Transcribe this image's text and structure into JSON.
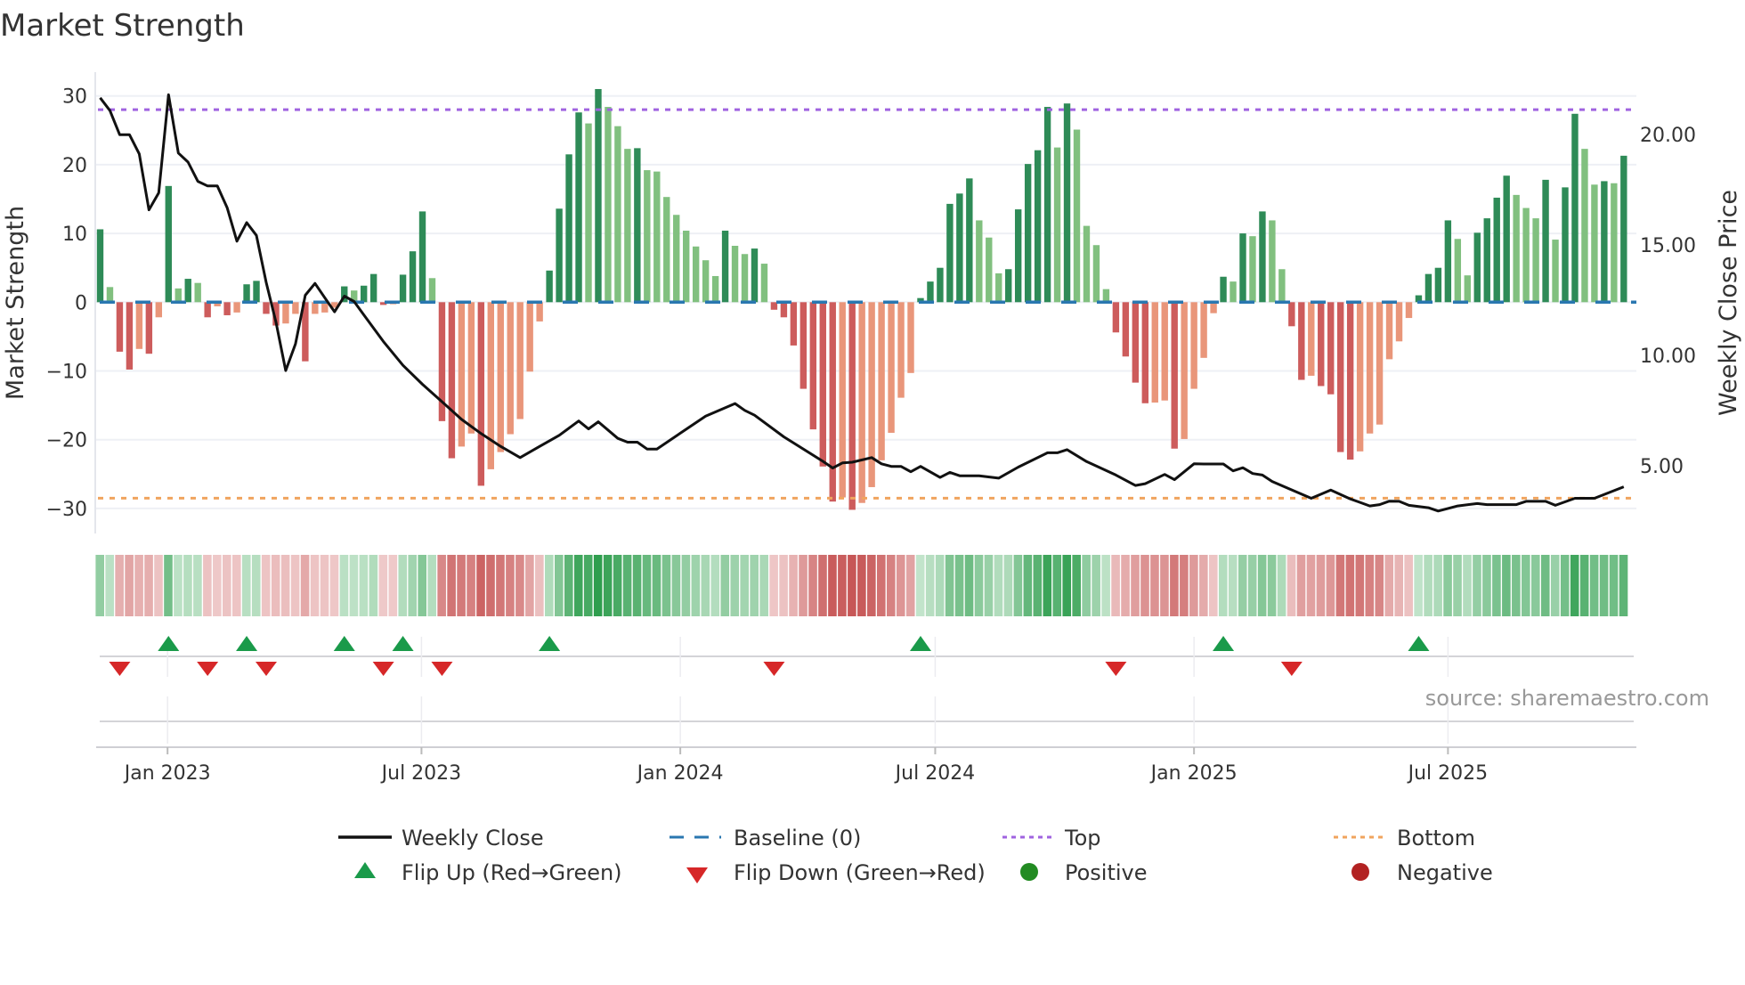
{
  "chart_data": {
    "type": "bar",
    "title": "Market Strength",
    "ylabel": "Market Strength",
    "y2label": "Weekly Close Price",
    "ylim": [
      -33,
      34
    ],
    "y2_ticks": [
      "20.00",
      "15.00",
      "10.00",
      "5.00"
    ],
    "y2_tick_values": [
      20,
      15,
      10,
      5
    ],
    "y_ticks": [
      "30",
      "20",
      "10",
      "0",
      "−10",
      "−20",
      "−30"
    ],
    "y_tick_values": [
      30,
      20,
      10,
      0,
      -10,
      -20,
      -30
    ],
    "x_ticks": [
      {
        "label": "Jan 2023",
        "week": 7.9
      },
      {
        "label": "Jul 2023",
        "week": 33.9
      },
      {
        "label": "Jan 2024",
        "week": 60.4
      },
      {
        "label": "Jul 2024",
        "week": 86.5
      },
      {
        "label": "Jan 2025",
        "week": 113.0
      },
      {
        "label": "Jul 2025",
        "week": 139.0
      }
    ],
    "top_level": 28.0,
    "bottom_level": -28.5,
    "baseline": 0,
    "strength": [
      10.6,
      2.2,
      -7.2,
      -9.8,
      -6.8,
      -7.5,
      -2.2,
      16.9,
      2.0,
      3.4,
      2.8,
      -2.2,
      -0.6,
      -1.9,
      -1.5,
      2.6,
      3.1,
      -1.7,
      -3.4,
      -3.1,
      -1.7,
      -8.6,
      -1.7,
      -1.5,
      -0.8,
      2.3,
      1.7,
      2.4,
      4.1,
      -0.4,
      -0.3,
      4.0,
      7.4,
      13.2,
      3.5,
      -17.3,
      -22.7,
      -21.0,
      -19.1,
      -26.7,
      -24.3,
      -21.8,
      -19.2,
      -17.0,
      -10.1,
      -2.8,
      4.6,
      13.6,
      21.5,
      27.6,
      26.0,
      31.0,
      28.4,
      25.6,
      22.3,
      22.4,
      19.2,
      19.0,
      15.3,
      12.7,
      10.4,
      8.1,
      6.1,
      3.8,
      10.4,
      8.2,
      7.0,
      7.8,
      5.6,
      -1.1,
      -2.2,
      -6.3,
      -12.6,
      -18.5,
      -23.9,
      -29.0,
      -28.4,
      -30.2,
      -29.2,
      -26.9,
      -23.0,
      -19.0,
      -13.9,
      -10.3,
      0.6,
      3.0,
      5.0,
      14.3,
      15.8,
      18.0,
      11.9,
      9.4,
      4.2,
      4.8,
      13.5,
      20.1,
      22.1,
      28.4,
      22.5,
      28.9,
      25.1,
      11.1,
      8.3,
      1.9,
      -4.4,
      -7.9,
      -11.7,
      -14.7,
      -14.6,
      -14.3,
      -21.3,
      -19.9,
      -12.6,
      -8.1,
      -1.6,
      3.7,
      3.0,
      10.0,
      9.6,
      13.2,
      11.9,
      4.8,
      -3.5,
      -11.3,
      -10.7,
      -12.2,
      -13.4,
      -21.8,
      -22.9,
      -21.7,
      -19.1,
      -17.8,
      -8.3,
      -5.7,
      -2.3,
      1.0,
      4.1,
      5.0,
      11.9,
      9.2,
      3.9,
      10.1,
      12.2,
      15.2,
      18.4,
      15.6,
      13.7,
      12.2,
      17.8,
      9.1,
      16.7,
      27.4,
      22.3,
      17.1,
      17.6,
      17.3,
      21.3
    ],
    "weekly_close": [
      [
        1,
        21.66
      ],
      [
        2,
        21.08
      ],
      [
        3,
        19.99
      ],
      [
        4,
        19.99
      ],
      [
        5,
        19.12
      ],
      [
        6,
        16.59
      ],
      [
        7,
        17.36
      ],
      [
        8,
        21.8
      ],
      [
        9,
        19.16
      ],
      [
        10,
        18.75
      ],
      [
        11,
        17.88
      ],
      [
        12,
        17.67
      ],
      [
        13,
        17.67
      ],
      [
        14,
        16.69
      ],
      [
        15,
        15.17
      ],
      [
        16,
        16.01
      ],
      [
        17,
        15.43
      ],
      [
        18,
        13.3
      ],
      [
        19,
        11.5
      ],
      [
        20,
        9.31
      ],
      [
        21,
        10.52
      ],
      [
        22,
        12.72
      ],
      [
        23,
        13.26
      ],
      [
        24,
        12.61
      ],
      [
        25,
        11.97
      ],
      [
        26,
        12.68
      ],
      [
        27,
        12.44
      ],
      [
        28,
        11.83
      ],
      [
        30,
        10.63
      ],
      [
        32,
        9.55
      ],
      [
        34,
        8.69
      ],
      [
        36,
        7.9
      ],
      [
        38,
        7.1
      ],
      [
        40,
        6.46
      ],
      [
        42,
        5.88
      ],
      [
        44,
        5.37
      ],
      [
        46,
        5.88
      ],
      [
        48,
        6.38
      ],
      [
        50,
        7.03
      ],
      [
        51,
        6.67
      ],
      [
        52,
        6.99
      ],
      [
        54,
        6.24
      ],
      [
        55,
        6.07
      ],
      [
        56,
        6.07
      ],
      [
        57,
        5.76
      ],
      [
        58,
        5.76
      ],
      [
        63,
        7.25
      ],
      [
        66,
        7.82
      ],
      [
        67,
        7.51
      ],
      [
        68,
        7.29
      ],
      [
        71,
        6.31
      ],
      [
        75,
        5.2
      ],
      [
        76,
        4.9
      ],
      [
        77,
        5.13
      ],
      [
        78,
        5.16
      ],
      [
        80,
        5.37
      ],
      [
        81,
        5.09
      ],
      [
        82,
        4.97
      ],
      [
        83,
        4.97
      ],
      [
        84,
        4.73
      ],
      [
        85,
        4.97
      ],
      [
        87,
        4.47
      ],
      [
        88,
        4.7
      ],
      [
        89,
        4.55
      ],
      [
        91,
        4.55
      ],
      [
        93,
        4.44
      ],
      [
        95,
        4.94
      ],
      [
        98,
        5.59
      ],
      [
        99,
        5.59
      ],
      [
        100,
        5.73
      ],
      [
        102,
        5.19
      ],
      [
        103,
        4.99
      ],
      [
        105,
        4.58
      ],
      [
        107,
        4.11
      ],
      [
        108,
        4.19
      ],
      [
        110,
        4.61
      ],
      [
        111,
        4.37
      ],
      [
        113,
        5.09
      ],
      [
        114,
        5.08
      ],
      [
        116,
        5.08
      ],
      [
        117,
        4.77
      ],
      [
        118,
        4.91
      ],
      [
        119,
        4.65
      ],
      [
        120,
        4.58
      ],
      [
        121,
        4.29
      ],
      [
        125,
        3.53
      ],
      [
        127,
        3.9
      ],
      [
        129,
        3.5
      ],
      [
        131,
        3.18
      ],
      [
        132,
        3.24
      ],
      [
        133,
        3.4
      ],
      [
        134,
        3.39
      ],
      [
        135,
        3.21
      ],
      [
        137,
        3.1
      ],
      [
        138,
        2.95
      ],
      [
        139,
        3.07
      ],
      [
        140,
        3.18
      ],
      [
        142,
        3.29
      ],
      [
        143,
        3.24
      ],
      [
        146,
        3.24
      ],
      [
        147,
        3.39
      ],
      [
        149,
        3.39
      ],
      [
        150,
        3.21
      ],
      [
        152,
        3.53
      ],
      [
        154,
        3.53
      ],
      [
        157,
        4.05
      ]
    ],
    "flip_up_weeks": [
      8,
      16,
      26,
      32,
      47,
      85,
      116,
      136
    ],
    "flip_down_weeks": [
      3,
      12,
      18,
      30,
      36,
      70,
      105,
      123
    ],
    "colors": {
      "rising_positive": "#2e8b57",
      "falling_positive": "#81c07f",
      "falling_negative": "#cd5c5c",
      "rising_negative": "#e9967a",
      "baseline": "#2a77b0",
      "top": "#a063e0",
      "bottom": "#f0a45e",
      "flip_up": "#1a9a4a",
      "flip_down": "#d62728",
      "positive": "#228b22",
      "negative": "#b22222"
    },
    "legend": {
      "position": "bottom-center",
      "items": [
        "Weekly Close",
        "Baseline (0)",
        "Top",
        "Bottom",
        "Flip Up (Red→Green)",
        "Flip Down (Green→Red)",
        "Positive",
        "Negative"
      ]
    },
    "source": "source: sharemaestro.com"
  }
}
